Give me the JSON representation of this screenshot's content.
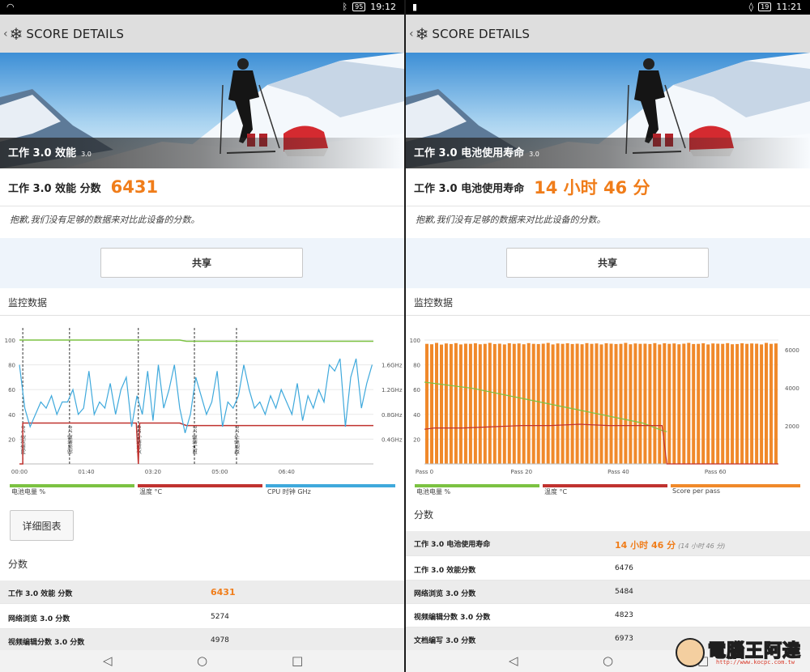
{
  "left": {
    "status": {
      "time": "19:12",
      "battery": "95"
    },
    "appbar": {
      "title": "SCORE DETAILS"
    },
    "hero": {
      "title": "工作 3.0 效能",
      "version": "3.0"
    },
    "score": {
      "label": "工作 3.0 效能 分数",
      "value": "6431"
    },
    "note": "抱歉,我们没有足够的数据来对比此设备的分数。",
    "share_label": "共享",
    "monitor_title": "监控数据",
    "chart_data": {
      "type": "line",
      "x_ticks": [
        "00:00",
        "01:40",
        "03:20",
        "05:00",
        "06:40"
      ],
      "y_ticks_left": [
        "20",
        "40",
        "60",
        "80",
        "100"
      ],
      "y_ticks_right": [
        "0.4GHz",
        "0.8GHz",
        "1.2GHz",
        "1.6GHz"
      ],
      "ylim_left": [
        0,
        100
      ],
      "ylim_right": [
        0,
        2.0
      ],
      "xlim_seconds": [
        0,
        530
      ],
      "markers": [
        {
          "t": 5,
          "label": "网络浏览 3.0"
        },
        {
          "t": 75,
          "label": "视频编辑 3.0"
        },
        {
          "t": 178,
          "label": "文档编写 3.0"
        },
        {
          "t": 262,
          "label": "图片编辑 3.0"
        },
        {
          "t": 325,
          "label": "数据操作 3.0"
        }
      ],
      "series": [
        {
          "name": "电池电量 %",
          "color": "#7cc242",
          "axis": "left",
          "x": [
            0,
            240,
            250,
            530
          ],
          "y": [
            100,
            100,
            99,
            99
          ]
        },
        {
          "name": "温度 °C",
          "color": "#c0322f",
          "axis": "left",
          "x": [
            0,
            5,
            5,
            175,
            178,
            180,
            240,
            250,
            530
          ],
          "y": [
            0,
            0,
            33,
            33,
            0,
            33,
            33,
            31,
            31
          ]
        },
        {
          "name": "CPU 时钟 GHz",
          "color": "#3fa9dc",
          "axis": "right",
          "x": [
            0,
            8,
            16,
            24,
            32,
            40,
            48,
            56,
            64,
            72,
            80,
            88,
            96,
            104,
            112,
            120,
            128,
            136,
            144,
            152,
            160,
            168,
            176,
            184,
            192,
            200,
            208,
            216,
            224,
            232,
            240,
            248,
            256,
            264,
            272,
            280,
            288,
            296,
            304,
            312,
            320,
            328,
            336,
            344,
            352,
            360,
            368,
            376,
            384,
            392,
            400,
            408,
            416,
            424,
            432,
            440,
            448,
            456,
            464,
            472,
            480,
            488,
            496,
            504,
            512,
            520,
            528
          ],
          "y": [
            1.6,
            0.9,
            0.6,
            0.8,
            1.0,
            0.9,
            1.1,
            0.8,
            1.0,
            1.0,
            1.2,
            0.8,
            0.9,
            1.5,
            0.8,
            1.0,
            0.9,
            1.3,
            0.8,
            1.2,
            1.4,
            0.6,
            1.1,
            0.8,
            1.5,
            0.7,
            1.6,
            0.9,
            1.2,
            1.6,
            0.9,
            0.5,
            0.8,
            1.4,
            1.1,
            0.8,
            1.0,
            1.5,
            0.6,
            1.0,
            0.9,
            1.1,
            1.6,
            1.2,
            0.9,
            1.0,
            0.8,
            1.1,
            0.9,
            1.2,
            1.0,
            0.8,
            1.3,
            0.7,
            1.1,
            0.9,
            1.2,
            1.0,
            1.6,
            1.5,
            1.7,
            0.6,
            1.4,
            1.7,
            0.9,
            1.3,
            1.6
          ]
        }
      ]
    },
    "legend": [
      "电池电量 %",
      "温度 °C",
      "CPU 时钟 GHz"
    ],
    "detail_button": "详细图表",
    "scores_title": "分数",
    "rows": [
      {
        "label": "工作 3.0 效能 分数",
        "value": "6431"
      },
      {
        "label": "网络浏览 3.0 分数",
        "value": "5274"
      },
      {
        "label": "视频编辑分数 3.0 分数",
        "value": "4978"
      }
    ]
  },
  "right": {
    "status": {
      "time": "11:21",
      "battery": "19"
    },
    "appbar": {
      "title": "SCORE DETAILS"
    },
    "hero": {
      "title": "工作 3.0 电池使用寿命",
      "version": "3.0"
    },
    "score": {
      "label": "工作 3.0 电池使用寿命",
      "value": "14 小时 46 分"
    },
    "note": "抱歉,我们没有足够的数据来对比此设备的分数。",
    "share_label": "共享",
    "monitor_title": "监控数据",
    "chart_data": {
      "type": "bar",
      "x_ticks": [
        "Pass 0",
        "Pass 20",
        "Pass 40",
        "Pass 60"
      ],
      "y_ticks_left": [
        "20",
        "40",
        "60",
        "80",
        "100"
      ],
      "y_ticks_right": [
        "2000",
        "4000",
        "6000"
      ],
      "ylim_left": [
        0,
        100
      ],
      "ylim_right": [
        0,
        6500
      ],
      "xlim_pass": [
        0,
        73
      ],
      "bars": {
        "name": "Score per pass",
        "color": "#f0892a",
        "count": 73,
        "values": [
          6300,
          6280,
          6350,
          6260,
          6320,
          6290,
          6340,
          6270,
          6310,
          6300,
          6330,
          6280,
          6300,
          6350,
          6290,
          6310,
          6270,
          6330,
          6300,
          6320,
          6280,
          6340,
          6300,
          6290,
          6310,
          6350,
          6270,
          6320,
          6300,
          6330,
          6290,
          6310,
          6280,
          6340,
          6300,
          6320,
          6270,
          6330,
          6310,
          6290,
          6300,
          6350,
          6280,
          6320,
          6300,
          6310,
          6290,
          6340,
          6270,
          6330,
          6300,
          6320,
          6280,
          6310,
          6350,
          6290,
          6300,
          6330,
          6270,
          6320,
          6310,
          6300,
          6340,
          6280,
          6290,
          6330,
          6300,
          6320,
          6310,
          6270,
          6350,
          6300,
          6320
        ]
      },
      "series": [
        {
          "name": "电池电量 %",
          "color": "#7cc242",
          "axis": "left",
          "x": [
            0,
            10,
            20,
            30,
            40,
            45,
            49,
            50
          ],
          "y": [
            66,
            61,
            53,
            45,
            37,
            33,
            27,
            26
          ]
        },
        {
          "name": "温度 °C",
          "color": "#c0322f",
          "axis": "left",
          "x": [
            0,
            2,
            8,
            14,
            20,
            26,
            32,
            38,
            44,
            49,
            50,
            51,
            73
          ],
          "y": [
            28,
            29,
            29,
            30,
            31,
            31,
            32,
            31,
            31,
            31,
            0,
            0,
            0
          ]
        }
      ]
    },
    "legend": [
      "电池电量 %",
      "温度 °C",
      "Score per pass"
    ],
    "scores_title": "分数",
    "rows": [
      {
        "label": "工作 3.0 电池使用寿命",
        "value": "14 小时 46 分",
        "sub": "(14 小时 46 分)"
      },
      {
        "label": "工作 3.0 效能分数",
        "value": "6476"
      },
      {
        "label": "网络浏览 3.0 分数",
        "value": "5484"
      },
      {
        "label": "视频编辑分数 3.0 分数",
        "value": "4823"
      },
      {
        "label": "文档编写 3.0 分数",
        "value": "6973"
      }
    ]
  },
  "watermark": {
    "text": "電腦王阿達",
    "url": "http://www.kocpc.com.tw"
  },
  "colors": {
    "accent": "#f07d1a",
    "battery": "#7cc242",
    "temp": "#c0322f",
    "cpu": "#3fa9dc",
    "bar": "#f0892a"
  },
  "icons": [
    "wifi-icon",
    "bluetooth-icon",
    "battery-icon",
    "back-icon",
    "snowflake-icon",
    "nav-back-icon",
    "nav-home-icon",
    "nav-recent-icon"
  ]
}
